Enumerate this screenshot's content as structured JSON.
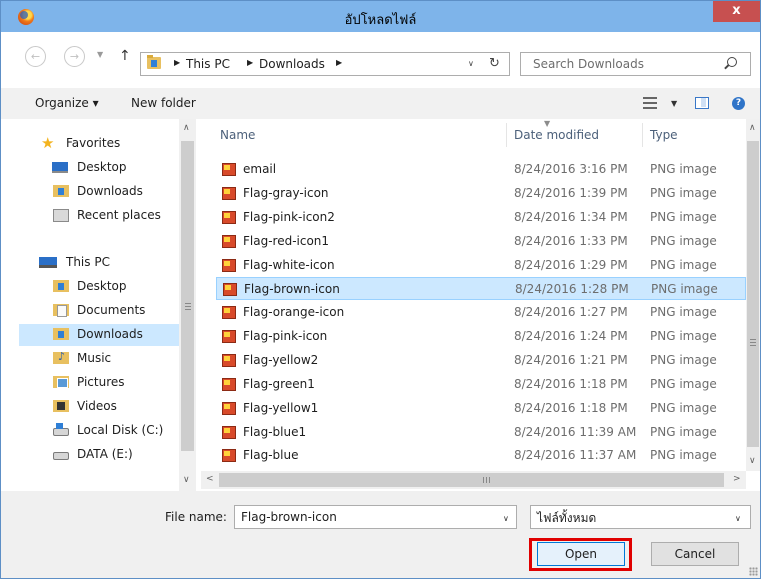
{
  "window": {
    "title": "อัปโหลดไฟล์",
    "close_label": "x",
    "app_icon": "firefox-icon"
  },
  "navigation": {
    "back_icon": "back-arrow-icon",
    "forward_icon": "forward-arrow-icon",
    "up_icon": "up-arrow-icon",
    "breadcrumbs": [
      "This PC",
      "Downloads"
    ],
    "refresh_icon": "refresh-icon",
    "search_placeholder": "Search Downloads"
  },
  "toolbar": {
    "organize_label": "Organize ▾",
    "new_folder_label": "New folder"
  },
  "sidebar": {
    "groups": [
      {
        "label": "Favorites",
        "icon": "star-icon",
        "items": [
          {
            "label": "Desktop",
            "icon": "desktop-icon"
          },
          {
            "label": "Downloads",
            "icon": "downloads-folder-icon"
          },
          {
            "label": "Recent places",
            "icon": "recent-places-icon"
          }
        ]
      },
      {
        "label": "This PC",
        "icon": "computer-icon",
        "items": [
          {
            "label": "Desktop",
            "icon": "desktop-folder-icon"
          },
          {
            "label": "Documents",
            "icon": "documents-folder-icon"
          },
          {
            "label": "Downloads",
            "icon": "downloads-folder-icon",
            "selected": true
          },
          {
            "label": "Music",
            "icon": "music-folder-icon"
          },
          {
            "label": "Pictures",
            "icon": "pictures-folder-icon"
          },
          {
            "label": "Videos",
            "icon": "videos-folder-icon"
          },
          {
            "label": "Local Disk (C:)",
            "icon": "system-drive-icon"
          },
          {
            "label": "DATA (E:)",
            "icon": "drive-icon"
          }
        ]
      }
    ]
  },
  "file_list": {
    "columns": [
      "Name",
      "Date modified",
      "Type"
    ],
    "rows": [
      {
        "name": "email",
        "date": "8/24/2016 3:16 PM",
        "type": "PNG image"
      },
      {
        "name": "Flag-gray-icon",
        "date": "8/24/2016 1:39 PM",
        "type": "PNG image"
      },
      {
        "name": "Flag-pink-icon2",
        "date": "8/24/2016 1:34 PM",
        "type": "PNG image"
      },
      {
        "name": "Flag-red-icon1",
        "date": "8/24/2016 1:33 PM",
        "type": "PNG image"
      },
      {
        "name": "Flag-white-icon",
        "date": "8/24/2016 1:29 PM",
        "type": "PNG image"
      },
      {
        "name": "Flag-brown-icon",
        "date": "8/24/2016 1:28 PM",
        "type": "PNG image",
        "selected": true
      },
      {
        "name": "Flag-orange-icon",
        "date": "8/24/2016 1:27 PM",
        "type": "PNG image"
      },
      {
        "name": "Flag-pink-icon",
        "date": "8/24/2016 1:24 PM",
        "type": "PNG image"
      },
      {
        "name": "Flag-yellow2",
        "date": "8/24/2016 1:21 PM",
        "type": "PNG image"
      },
      {
        "name": "Flag-green1",
        "date": "8/24/2016 1:18 PM",
        "type": "PNG image"
      },
      {
        "name": "Flag-yellow1",
        "date": "8/24/2016 1:18 PM",
        "type": "PNG image"
      },
      {
        "name": "Flag-blue1",
        "date": "8/24/2016 11:39 AM",
        "type": "PNG image"
      },
      {
        "name": "Flag-blue",
        "date": "8/24/2016 11:37 AM",
        "type": "PNG image"
      }
    ]
  },
  "footer": {
    "file_name_label": "File name:",
    "file_name_value": "Flag-brown-icon",
    "file_type_value": "ไฟล์ทั้งหมด",
    "open_label": "Open",
    "cancel_label": "Cancel"
  },
  "colors": {
    "titlebar": "#7eb4ea",
    "close_button": "#c75050",
    "selection": "#cce8ff",
    "highlight_border": "#e00000"
  }
}
